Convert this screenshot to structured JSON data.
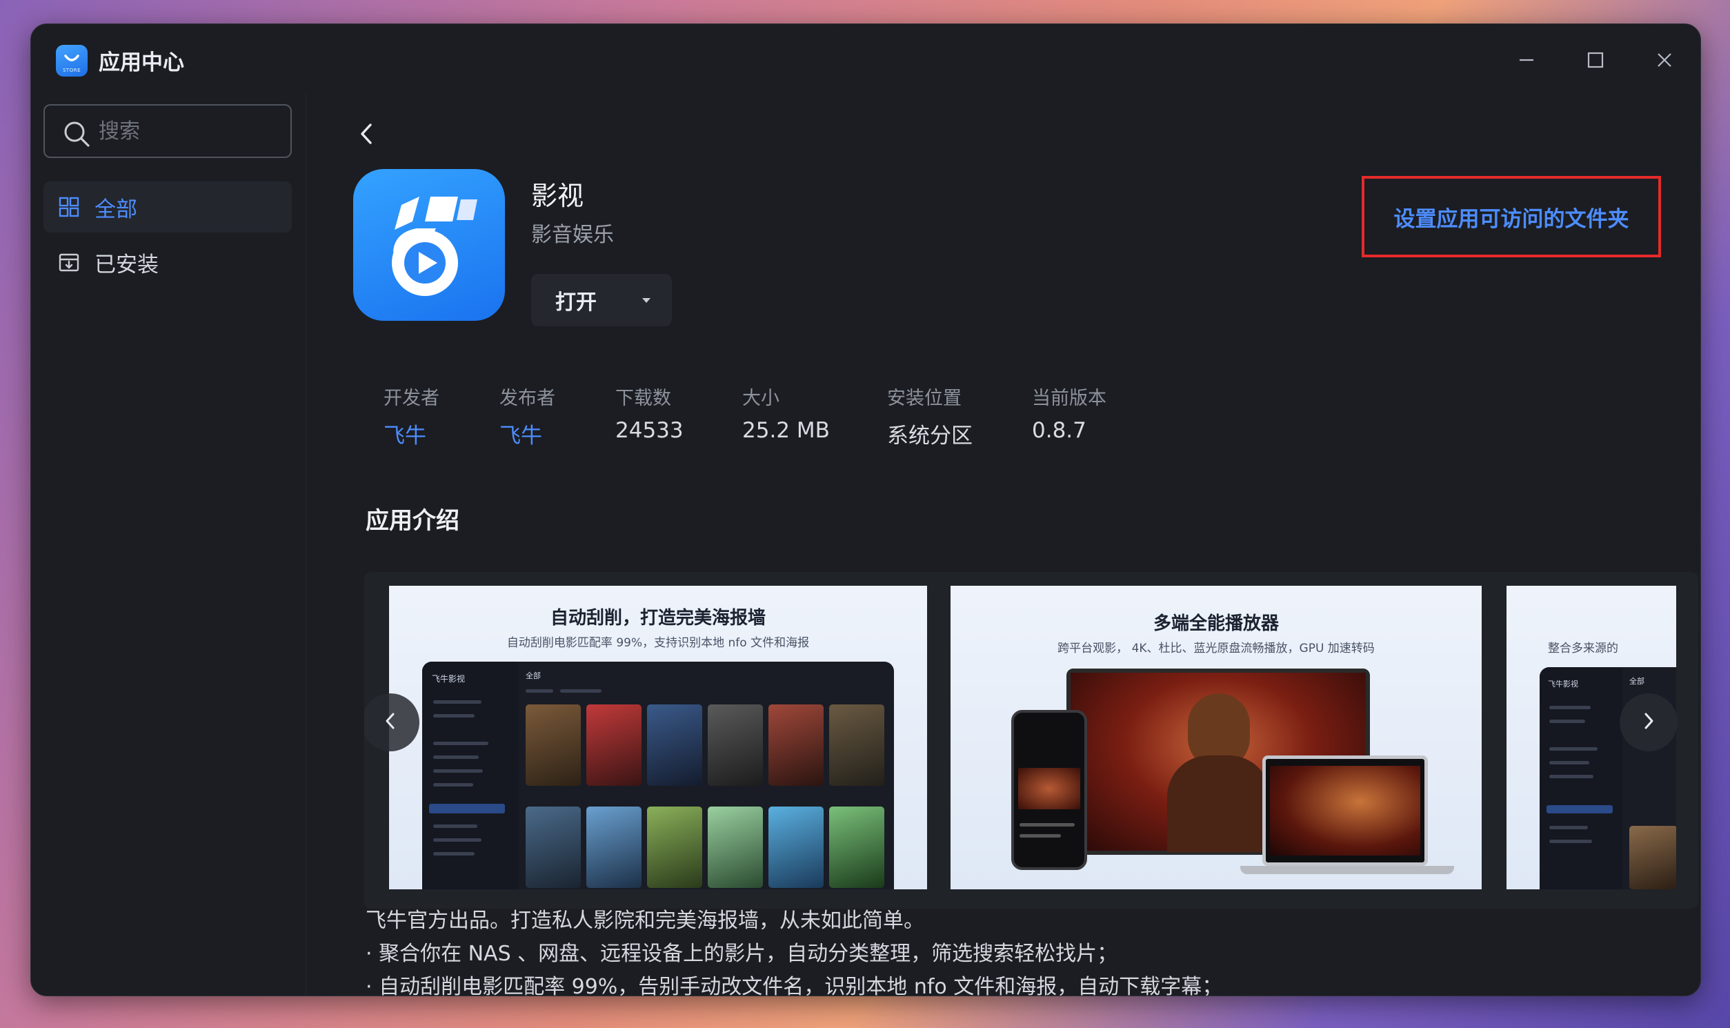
{
  "window": {
    "title": "应用中心",
    "logo_text": "STORE"
  },
  "sidebar": {
    "search_placeholder": "搜索",
    "items": [
      {
        "label": "全部",
        "icon": "grid-icon",
        "active": true
      },
      {
        "label": "已安装",
        "icon": "download-box-icon",
        "active": false
      }
    ]
  },
  "app": {
    "name": "影视",
    "category": "影音娱乐",
    "open_label": "打开",
    "folder_button": "设置应用可访问的文件夹",
    "info": [
      {
        "label": "开发者",
        "value": "飞牛",
        "link": true
      },
      {
        "label": "发布者",
        "value": "飞牛",
        "link": true
      },
      {
        "label": "下载数",
        "value": "24533",
        "link": false
      },
      {
        "label": "大小",
        "value": "25.2 MB",
        "link": false
      },
      {
        "label": "安装位置",
        "value": "系统分区",
        "link": false
      },
      {
        "label": "当前版本",
        "value": "0.8.7",
        "link": false
      }
    ]
  },
  "intro": {
    "title": "应用介绍",
    "screenshots": [
      {
        "title": "自动刮削，打造完美海报墙",
        "subtitle": "自动刮削电影匹配率 99%，支持识别本地 nfo 文件和海报",
        "mock_brand": "飞牛影视",
        "mock_tab": "全部"
      },
      {
        "title": "多端全能播放器",
        "subtitle": "跨平台观影， 4K、杜比、蓝光原盘流畅播放，GPU 加速转码"
      },
      {
        "subtitle": "整合多来源的",
        "mock_brand": "飞牛影视",
        "mock_tab": "全部"
      }
    ],
    "description": [
      "飞牛官方出品。打造私人影院和完美海报墙，从未如此简单。",
      "· 聚合你在 NAS 、网盘、远程设备上的影片，自动分类整理，筛选搜索轻松找片；",
      "· 自动刮削电影匹配率 99%，告别手动改文件名，识别本地 nfo 文件和海报，自动下载字幕；"
    ]
  },
  "colors": {
    "accent": "#4d8dff",
    "highlight_border": "#e42a2a",
    "window_bg": "#1b1d22"
  }
}
